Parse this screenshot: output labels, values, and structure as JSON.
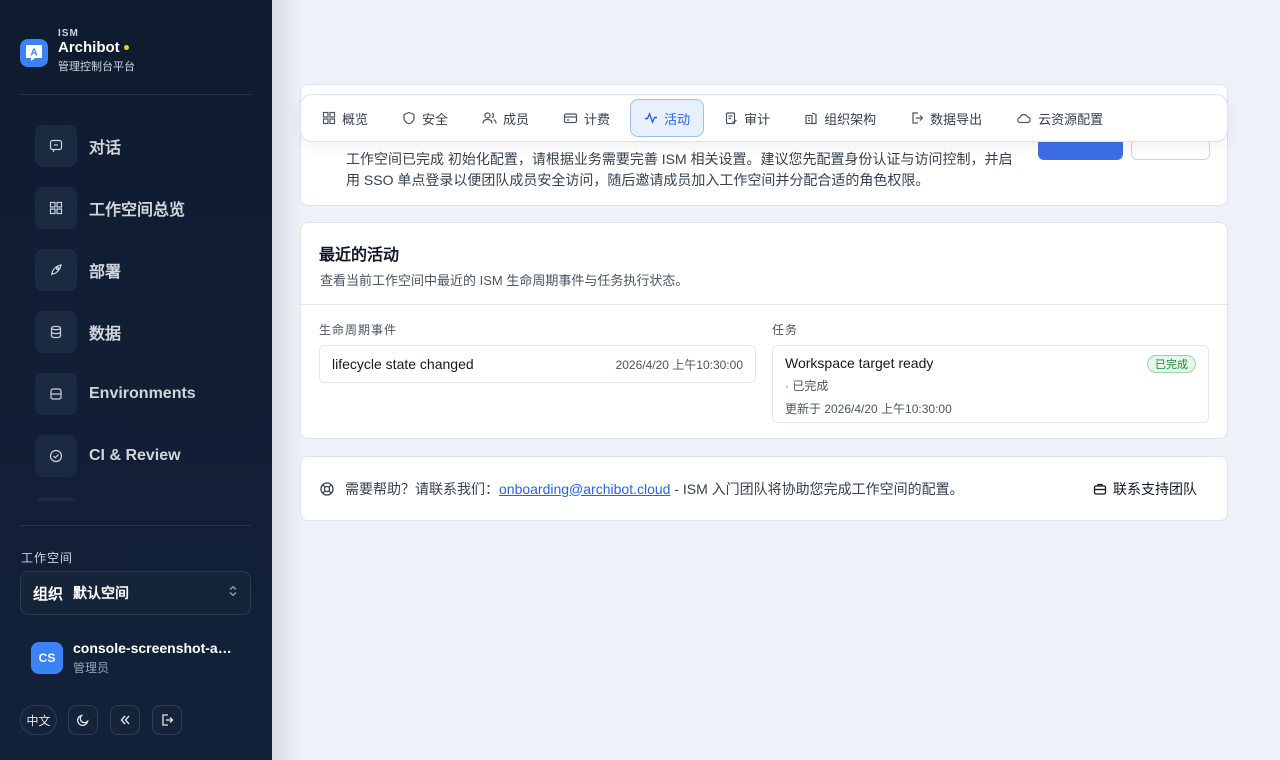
{
  "brand": {
    "tag": "ISM",
    "name": "Archibot",
    "subtitle": "管理控制台平台"
  },
  "nav": {
    "items": [
      {
        "label": "对话",
        "icon": "chat-icon"
      },
      {
        "label": "工作空间总览",
        "icon": "grid-icon"
      },
      {
        "label": "部署",
        "icon": "rocket-icon"
      },
      {
        "label": "数据",
        "icon": "database-icon"
      },
      {
        "label": "Environments",
        "icon": "server-icon"
      },
      {
        "label": "CI & Review",
        "icon": "check-circle-icon"
      }
    ]
  },
  "workspace": {
    "label": "工作空间",
    "selected_icon": "组织",
    "selected": "默认空间"
  },
  "user": {
    "initials": "CS",
    "name": "console-screenshot-admin",
    "role": "管理员"
  },
  "footer": {
    "lang_label": "中文",
    "theme_icon": "moon-icon",
    "collapse_icon": "chevrons-left-icon",
    "logout_icon": "logout-icon"
  },
  "alert": {
    "text": "工作空间已完成 初始化配置，请根据业务需要完善 ISM 相关设置。建议您先配置身份认证与访问控制，并启用 SSO 单点登录以便团队成员安全访问，随后邀请成员加入工作空间并分配合适的角色权限。"
  },
  "tabs": [
    {
      "label": "概览",
      "icon": "grid-icon",
      "active": false
    },
    {
      "label": "安全",
      "icon": "shield-icon",
      "active": false
    },
    {
      "label": "成员",
      "icon": "users-icon",
      "active": false
    },
    {
      "label": "计费",
      "icon": "card-icon",
      "active": false
    },
    {
      "label": "活动",
      "icon": "activity-icon",
      "active": true
    },
    {
      "label": "审计",
      "icon": "clipboard-check-icon",
      "active": false
    },
    {
      "label": "组织架构",
      "icon": "building-icon",
      "active": false
    },
    {
      "label": "数据导出",
      "icon": "export-icon",
      "active": false
    },
    {
      "label": "云资源配置",
      "icon": "cloud-icon",
      "active": false
    }
  ],
  "activity": {
    "title": "最近的活动",
    "description": "查看当前工作空间中最近的 ISM 生命周期事件与任务执行状态。",
    "events_label": "生命周期事件",
    "event": {
      "name": "lifecycle state changed",
      "time": "2026/4/20 上午10:30:00"
    },
    "tasks_label": "任务",
    "task": {
      "name": "Workspace target ready",
      "badge": "已完成",
      "meta": "· 已完成",
      "time": "更新于 2026/4/20 上午10:30:00"
    }
  },
  "support": {
    "prefix": "需要帮助？请联系我们：",
    "email": "onboarding@archibot.cloud",
    "suffix": " - ISM 入门团队将协助您完成工作空间的配置。",
    "button_label": "联系支持团队"
  }
}
